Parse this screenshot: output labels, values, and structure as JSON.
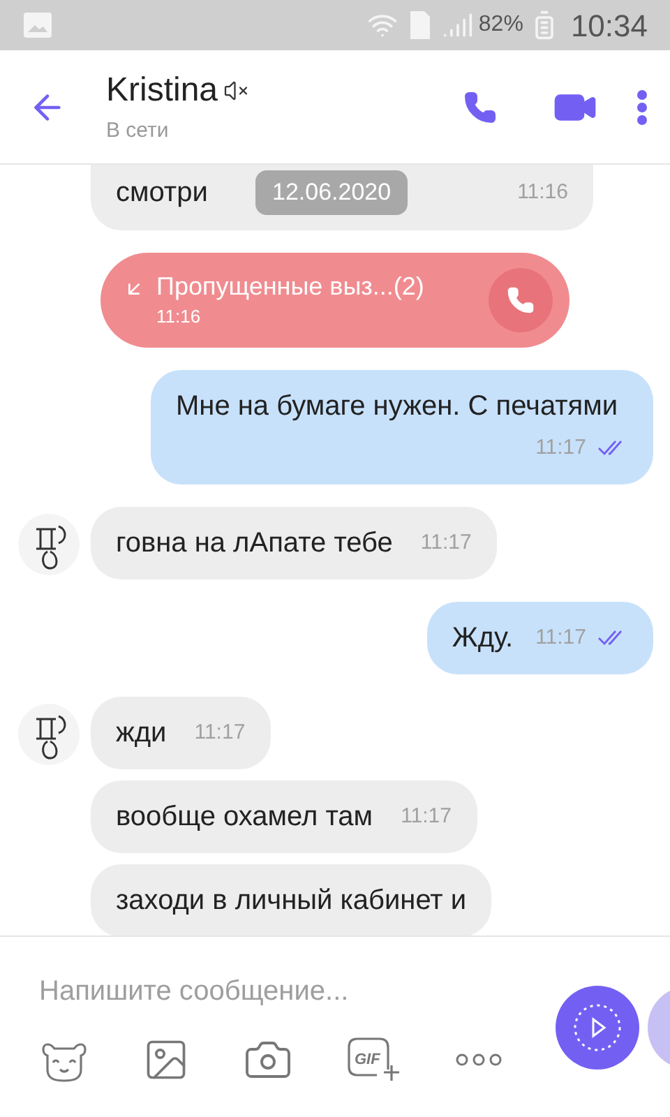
{
  "status_bar": {
    "battery": "82%",
    "time": "10:34"
  },
  "header": {
    "name": "Kristina",
    "muted": true,
    "status": "В сети"
  },
  "date_chip": "12.06.2020",
  "messages": [
    {
      "kind": "incoming",
      "text": "смотри",
      "time": "11:16",
      "show_avatar": false
    },
    {
      "kind": "missed_call",
      "text": "Пропущенные выз...(2)",
      "time": "11:16"
    },
    {
      "kind": "outgoing",
      "text": "Мне на бумаге нужен. С печатями",
      "time": "11:17",
      "read": true
    },
    {
      "kind": "incoming",
      "text": "говна на лАпате тебе",
      "time": "11:17",
      "show_avatar": true
    },
    {
      "kind": "outgoing",
      "text": "Жду.",
      "time": "11:17",
      "read": true
    },
    {
      "kind": "incoming",
      "text": "жди",
      "time": "11:17",
      "show_avatar": true
    },
    {
      "kind": "incoming",
      "text": "вообще охамел там",
      "time": "11:17",
      "show_avatar": false
    },
    {
      "kind": "incoming",
      "text": "заходи в личный кабинет и",
      "show_avatar": false
    }
  ],
  "composer": {
    "placeholder": "Напишите сообщение...",
    "gif_label": "GIF"
  }
}
